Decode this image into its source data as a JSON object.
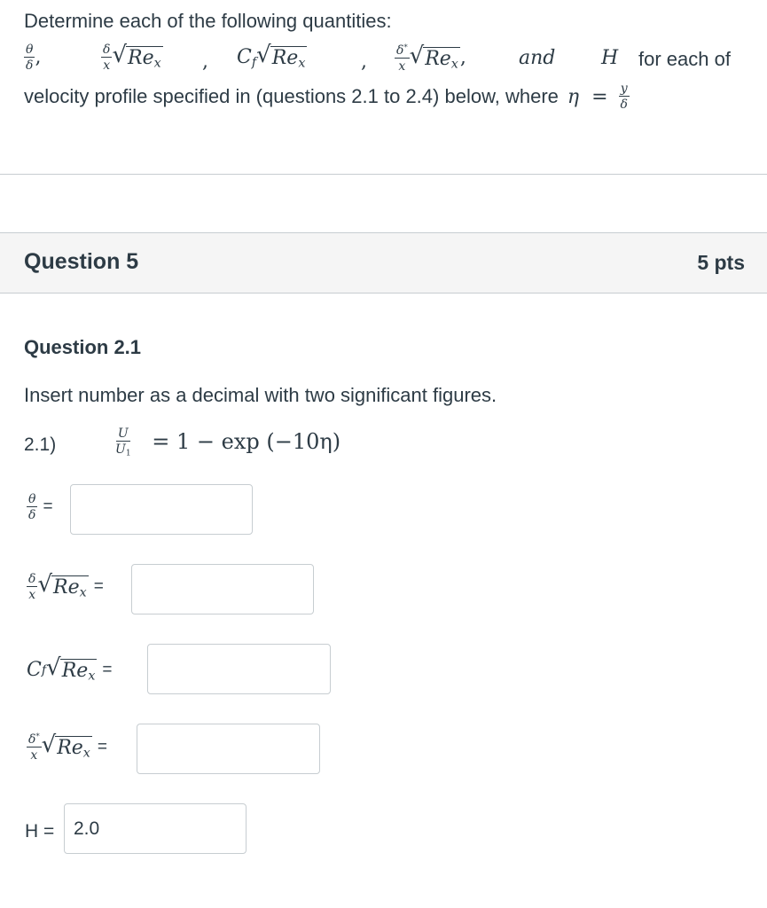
{
  "intro": {
    "line1": "Determine each of the following quantities:",
    "frac_theta_num": "θ",
    "frac_theta_den": "δ",
    "frac_delta_num": "δ",
    "frac_x": "x",
    "re": "Re",
    "x_sub": "x",
    "cf": "C",
    "f_sub": "f",
    "delta_star": "δ",
    "star": "*",
    "and": "and",
    "H": "H",
    "for_each_of": "for each of",
    "line3_prefix": "velocity profile specified in (questions 2.1 to 2.4) below, where",
    "eta": "η",
    "equals": "=",
    "y": "y"
  },
  "question": {
    "title": "Question 5",
    "points": "5 pts"
  },
  "subquestion": {
    "title": "Question 2.1",
    "instruction": "Insert number as a decimal with two significant figures.",
    "label": "2.1)",
    "eq_lhs_num": "U",
    "eq_lhs_den": "U",
    "eq_lhs_den_sub": "1",
    "eq_rhs": "= 1 − exp (−10η)"
  },
  "answers": {
    "equals": "=",
    "h_label": "H =",
    "theta_delta_value": "",
    "delta_x_value": "",
    "cf_value": "",
    "delta_star_value": "",
    "h_value": "2.0"
  }
}
